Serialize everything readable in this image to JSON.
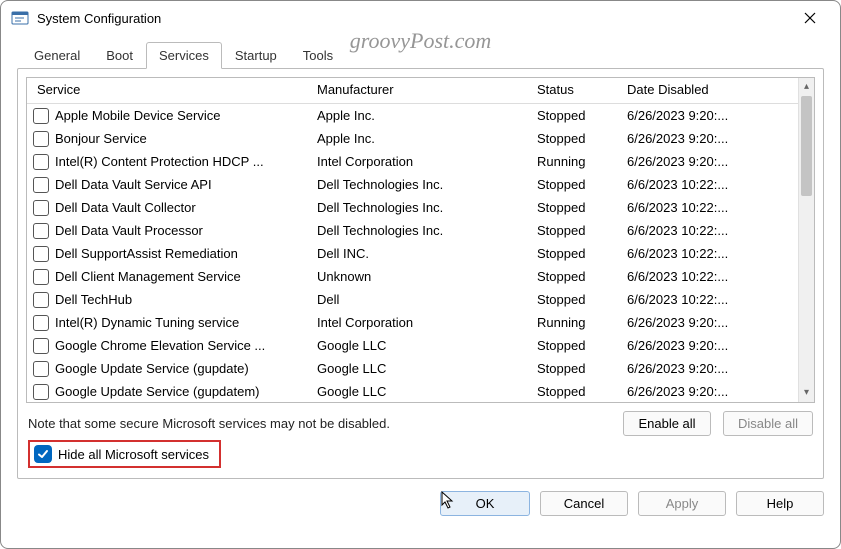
{
  "window": {
    "title": "System Configuration"
  },
  "watermark": "groovyPost.com",
  "tabs": {
    "items": [
      "General",
      "Boot",
      "Services",
      "Startup",
      "Tools"
    ],
    "activeIndex": 2
  },
  "columns": {
    "service": "Service",
    "manufacturer": "Manufacturer",
    "status": "Status",
    "dateDisabled": "Date Disabled"
  },
  "rows": [
    {
      "checked": false,
      "service": "Apple Mobile Device Service",
      "manufacturer": "Apple Inc.",
      "status": "Stopped",
      "date": "6/26/2023 9:20:..."
    },
    {
      "checked": false,
      "service": "Bonjour Service",
      "manufacturer": "Apple Inc.",
      "status": "Stopped",
      "date": "6/26/2023 9:20:..."
    },
    {
      "checked": false,
      "service": "Intel(R) Content Protection HDCP ...",
      "manufacturer": "Intel Corporation",
      "status": "Running",
      "date": "6/26/2023 9:20:..."
    },
    {
      "checked": false,
      "service": "Dell Data Vault Service API",
      "manufacturer": "Dell Technologies Inc.",
      "status": "Stopped",
      "date": "6/6/2023 10:22:..."
    },
    {
      "checked": false,
      "service": "Dell Data Vault Collector",
      "manufacturer": "Dell Technologies Inc.",
      "status": "Stopped",
      "date": "6/6/2023 10:22:..."
    },
    {
      "checked": false,
      "service": "Dell Data Vault Processor",
      "manufacturer": "Dell Technologies Inc.",
      "status": "Stopped",
      "date": "6/6/2023 10:22:..."
    },
    {
      "checked": false,
      "service": "Dell SupportAssist Remediation",
      "manufacturer": "Dell INC.",
      "status": "Stopped",
      "date": "6/6/2023 10:22:..."
    },
    {
      "checked": false,
      "service": "Dell Client Management Service",
      "manufacturer": "Unknown",
      "status": "Stopped",
      "date": "6/6/2023 10:22:..."
    },
    {
      "checked": false,
      "service": "Dell TechHub",
      "manufacturer": "Dell",
      "status": "Stopped",
      "date": "6/6/2023 10:22:..."
    },
    {
      "checked": false,
      "service": "Intel(R) Dynamic Tuning service",
      "manufacturer": "Intel Corporation",
      "status": "Running",
      "date": "6/26/2023 9:20:..."
    },
    {
      "checked": false,
      "service": "Google Chrome Elevation Service ...",
      "manufacturer": "Google LLC",
      "status": "Stopped",
      "date": "6/26/2023 9:20:..."
    },
    {
      "checked": false,
      "service": "Google Update Service (gupdate)",
      "manufacturer": "Google LLC",
      "status": "Stopped",
      "date": "6/26/2023 9:20:..."
    },
    {
      "checked": false,
      "service": "Google Update Service (gupdatem)",
      "manufacturer": "Google LLC",
      "status": "Stopped",
      "date": "6/26/2023 9:20:..."
    }
  ],
  "note": "Note that some secure Microsoft services may not be disabled.",
  "buttons": {
    "enableAll": "Enable all",
    "disableAll": "Disable all",
    "ok": "OK",
    "cancel": "Cancel",
    "apply": "Apply",
    "help": "Help"
  },
  "hideCheckbox": {
    "label": "Hide all Microsoft services",
    "checked": true
  }
}
